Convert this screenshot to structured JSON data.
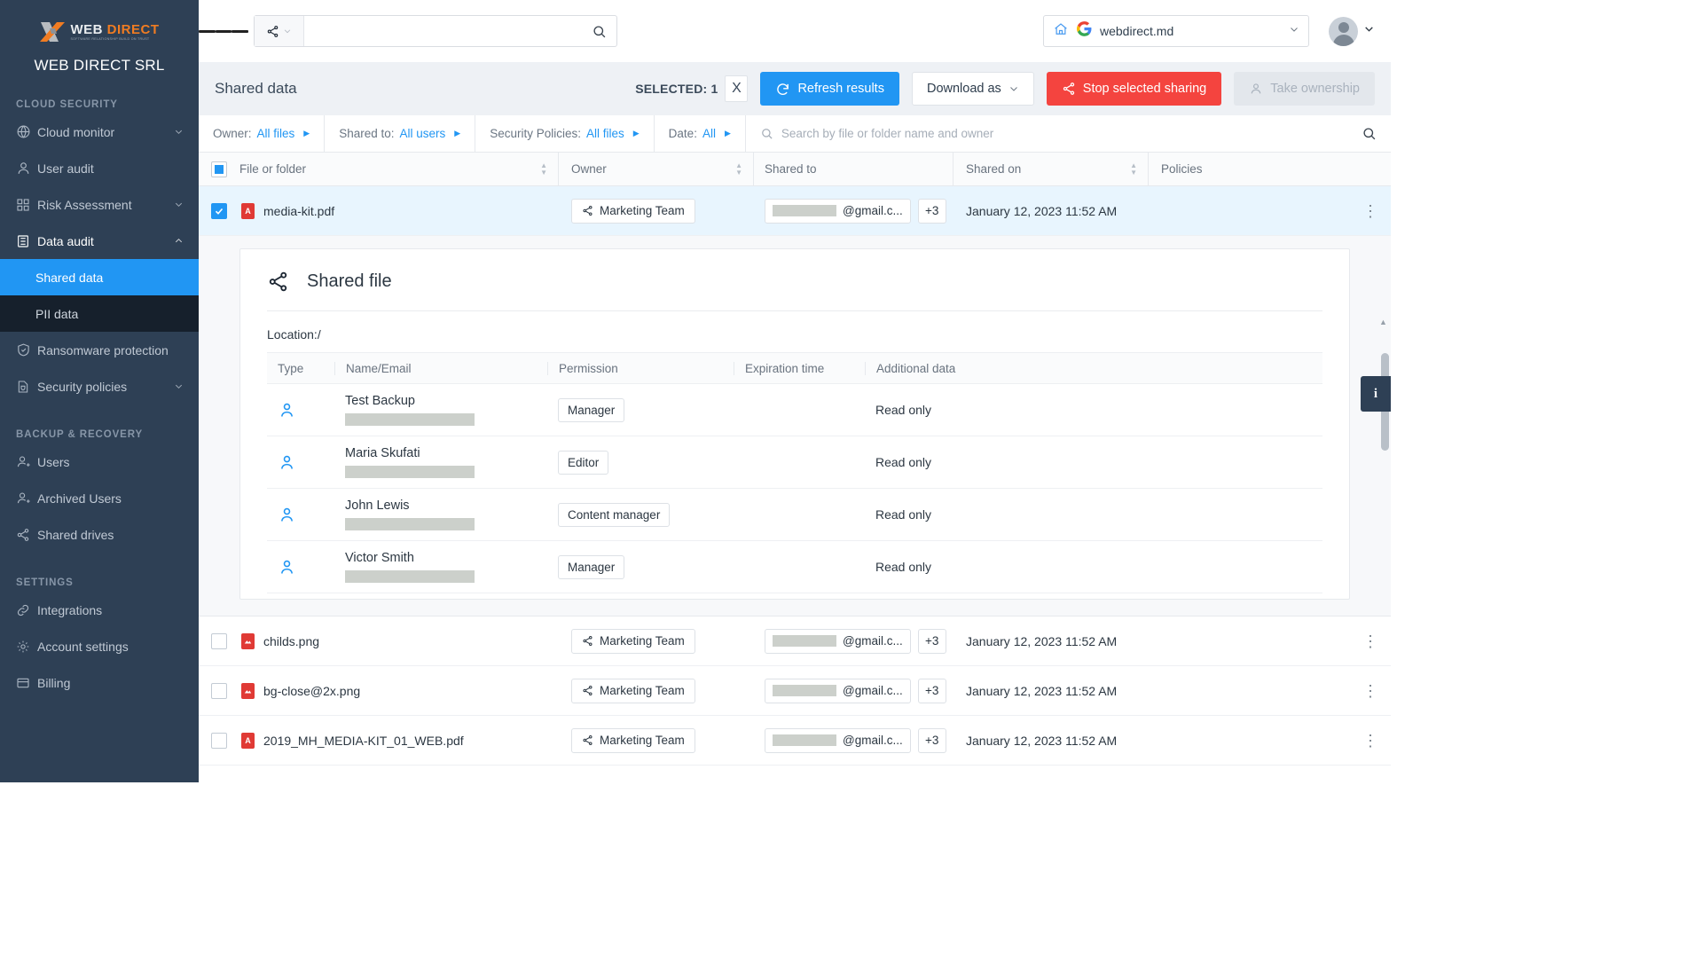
{
  "sidebar": {
    "logo": {
      "word1": "WEB",
      "word2": "DIRECT",
      "tagline": "SOFTWARE RELATIONSHIP BUILD ON TRUST"
    },
    "org_name": "WEB DIRECT SRL",
    "sections": [
      {
        "title": "CLOUD SECURITY",
        "items": [
          {
            "label": "Cloud monitor",
            "icon": "globe-icon",
            "chevron": "chevron-down"
          },
          {
            "label": "User audit",
            "icon": "user-icon",
            "chevron": ""
          },
          {
            "label": "Risk Assessment",
            "icon": "grid-icon",
            "chevron": "chevron-down"
          },
          {
            "label": "Data audit",
            "icon": "database-icon",
            "chevron": "chevron-up",
            "expanded": true
          },
          {
            "label": "Ransomware protection",
            "icon": "shield-check-icon",
            "chevron": ""
          },
          {
            "label": "Security policies",
            "icon": "policy-shield-icon",
            "chevron": "chevron-down"
          }
        ],
        "subitems": [
          {
            "label": "Shared data",
            "active": true
          },
          {
            "label": "PII data",
            "active": false
          }
        ]
      },
      {
        "title": "BACKUP & RECOVERY",
        "items": [
          {
            "label": "Users",
            "icon": "user-add-icon",
            "chevron": ""
          },
          {
            "label": "Archived Users",
            "icon": "user-archive-icon",
            "chevron": ""
          },
          {
            "label": "Shared drives",
            "icon": "share-icon",
            "chevron": ""
          }
        ],
        "subitems": []
      },
      {
        "title": "SETTINGS",
        "items": [
          {
            "label": "Integrations",
            "icon": "link-icon",
            "chevron": ""
          },
          {
            "label": "Account settings",
            "icon": "gear-icon",
            "chevron": ""
          },
          {
            "label": "Billing",
            "icon": "card-icon",
            "chevron": ""
          }
        ],
        "subitems": []
      }
    ]
  },
  "topbar": {
    "menu_icon": "hamburger-icon",
    "search_type_icon": "share-icon",
    "search_value": "",
    "search_placeholder": "",
    "search_icon": "search-icon",
    "tenant": {
      "home_icon": "home-icon",
      "provider_icon": "google-icon",
      "name": "webdirect.md",
      "chevron": "chevron-down-icon"
    },
    "avatar_chevron": "chevron-down-icon"
  },
  "toolbar": {
    "page_title": "Shared data",
    "selected_label": "SELECTED: 1",
    "clear_label": "X",
    "refresh_label": "Refresh results",
    "download_label": "Download as",
    "stop_sharing_label": "Stop selected sharing",
    "take_ownership_label": "Take ownership"
  },
  "filters": [
    {
      "label": "Owner:",
      "value": "All files"
    },
    {
      "label": "Shared to:",
      "value": "All users"
    },
    {
      "label": "Security Policies:",
      "value": "All files"
    },
    {
      "label": "Date:",
      "value": "All"
    }
  ],
  "filter_search": {
    "placeholder": "Search by file or folder name and owner",
    "value": "",
    "icon": "search-icon"
  },
  "table": {
    "headers": {
      "file": "File or folder",
      "owner": "Owner",
      "shared_to": "Shared to",
      "shared_on": "Shared on",
      "policies": "Policies"
    },
    "rows": [
      {
        "name": "media-kit.pdf",
        "type": "pdf",
        "owner": "Marketing Team",
        "shared_to_suffix": "@gmail.c...",
        "shared_to_more": "+3",
        "shared_on": "January 12, 2023 11:52 AM",
        "policies": "",
        "selected": true,
        "expanded": true
      },
      {
        "name": "childs.png",
        "type": "png",
        "owner": "Marketing Team",
        "shared_to_suffix": "@gmail.c...",
        "shared_to_more": "+3",
        "shared_on": "January 12, 2023 11:52 AM",
        "policies": "",
        "selected": false,
        "expanded": false
      },
      {
        "name": "bg-close@2x.png",
        "type": "png",
        "owner": "Marketing Team",
        "shared_to_suffix": "@gmail.c...",
        "shared_to_more": "+3",
        "shared_on": "January 12, 2023 11:52 AM",
        "policies": "",
        "selected": false,
        "expanded": false
      },
      {
        "name": "2019_MH_MEDIA-KIT_01_WEB.pdf",
        "type": "pdf",
        "owner": "Marketing Team",
        "shared_to_suffix": "@gmail.c...",
        "shared_to_more": "+3",
        "shared_on": "January 12, 2023 11:52 AM",
        "policies": "",
        "selected": false,
        "expanded": false
      }
    ]
  },
  "detail_panel": {
    "title": "Shared file",
    "icon": "share-icon",
    "location_label": "Location:/",
    "headers": {
      "type": "Type",
      "name_email": "Name/Email",
      "permission": "Permission",
      "expiration": "Expiration time",
      "additional": "Additional data"
    },
    "rows": [
      {
        "name": "Test Backup",
        "email_redacted": true,
        "permission": "Manager",
        "expiration": "",
        "additional": "Read only"
      },
      {
        "name": "Maria Skufati",
        "email_redacted": true,
        "permission": "Editor",
        "expiration": "",
        "additional": "Read only"
      },
      {
        "name": "John Lewis",
        "email_redacted": true,
        "permission": "Content manager",
        "expiration": "",
        "additional": "Read only"
      },
      {
        "name": "Victor Smith",
        "email_redacted": true,
        "permission": "Manager",
        "expiration": "",
        "additional": "Read only"
      }
    ]
  },
  "info_tab": {
    "label": "i"
  },
  "colors": {
    "sidebar_bg": "#2e4055",
    "accent_blue": "#2196f3",
    "danger_red": "#f4443f",
    "selected_row": "#e8f5fe",
    "logo_orange": "#f07c22"
  }
}
